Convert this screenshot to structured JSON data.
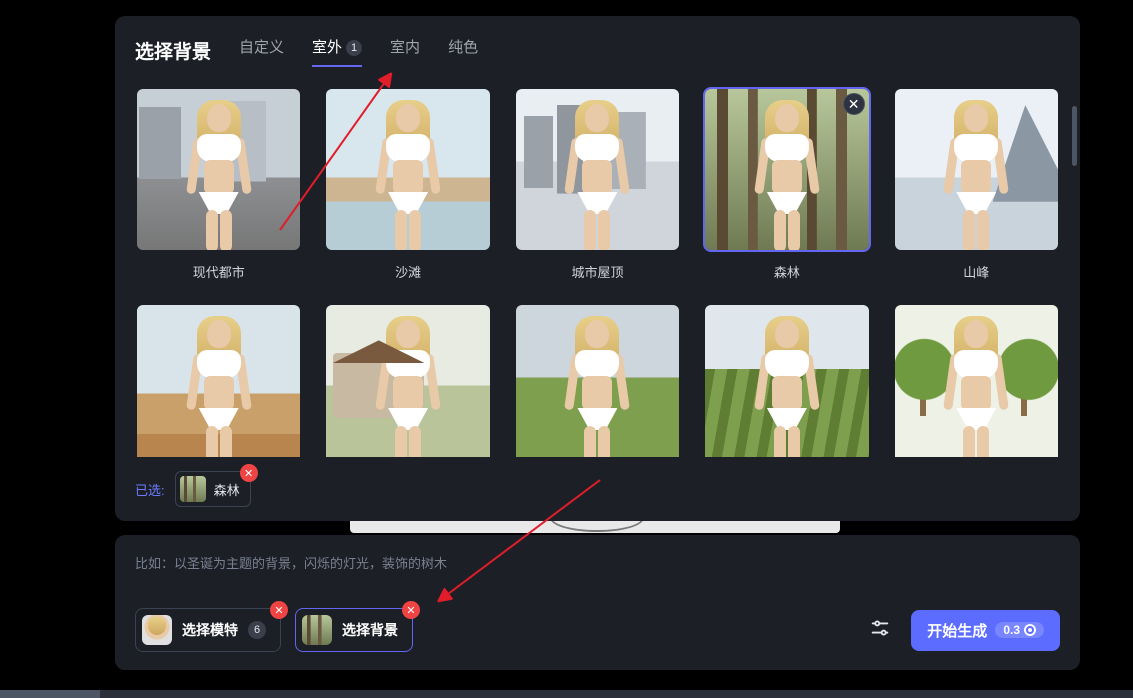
{
  "panel": {
    "title": "选择背景",
    "tabs": [
      {
        "label": "自定义",
        "active": false
      },
      {
        "label": "室外",
        "active": true,
        "badge": "1"
      },
      {
        "label": "室内",
        "active": false
      },
      {
        "label": "纯色",
        "active": false
      }
    ],
    "backgrounds": [
      {
        "id": "city",
        "label": "现代都市",
        "bgClass": "bg-city"
      },
      {
        "id": "beach",
        "label": "沙滩",
        "bgClass": "bg-beach"
      },
      {
        "id": "roof",
        "label": "城市屋顶",
        "bgClass": "bg-roof"
      },
      {
        "id": "forest",
        "label": "森林",
        "bgClass": "bg-forest",
        "selected": true
      },
      {
        "id": "peak",
        "label": "山峰",
        "bgClass": "bg-peak"
      },
      {
        "id": "desert",
        "label": "",
        "bgClass": "bg-desert"
      },
      {
        "id": "farm",
        "label": "",
        "bgClass": "bg-farm"
      },
      {
        "id": "grass",
        "label": "",
        "bgClass": "bg-grass"
      },
      {
        "id": "vine",
        "label": "",
        "bgClass": "bg-vine"
      },
      {
        "id": "park",
        "label": "",
        "bgClass": "bg-park"
      }
    ],
    "selected_label": "已选:",
    "selected_item": {
      "label": "森林",
      "miniClass": "mini-forest"
    }
  },
  "bottom": {
    "hint": "比如：以圣诞为主题的背景，闪烁的灯光，装饰的树木",
    "model_pill": {
      "label": "选择模特",
      "count": "6",
      "miniClass": "mini-face"
    },
    "bg_pill": {
      "label": "选择背景",
      "miniClass": "mini-forest"
    },
    "generate": {
      "label": "开始生成",
      "cost": "0.3"
    }
  }
}
